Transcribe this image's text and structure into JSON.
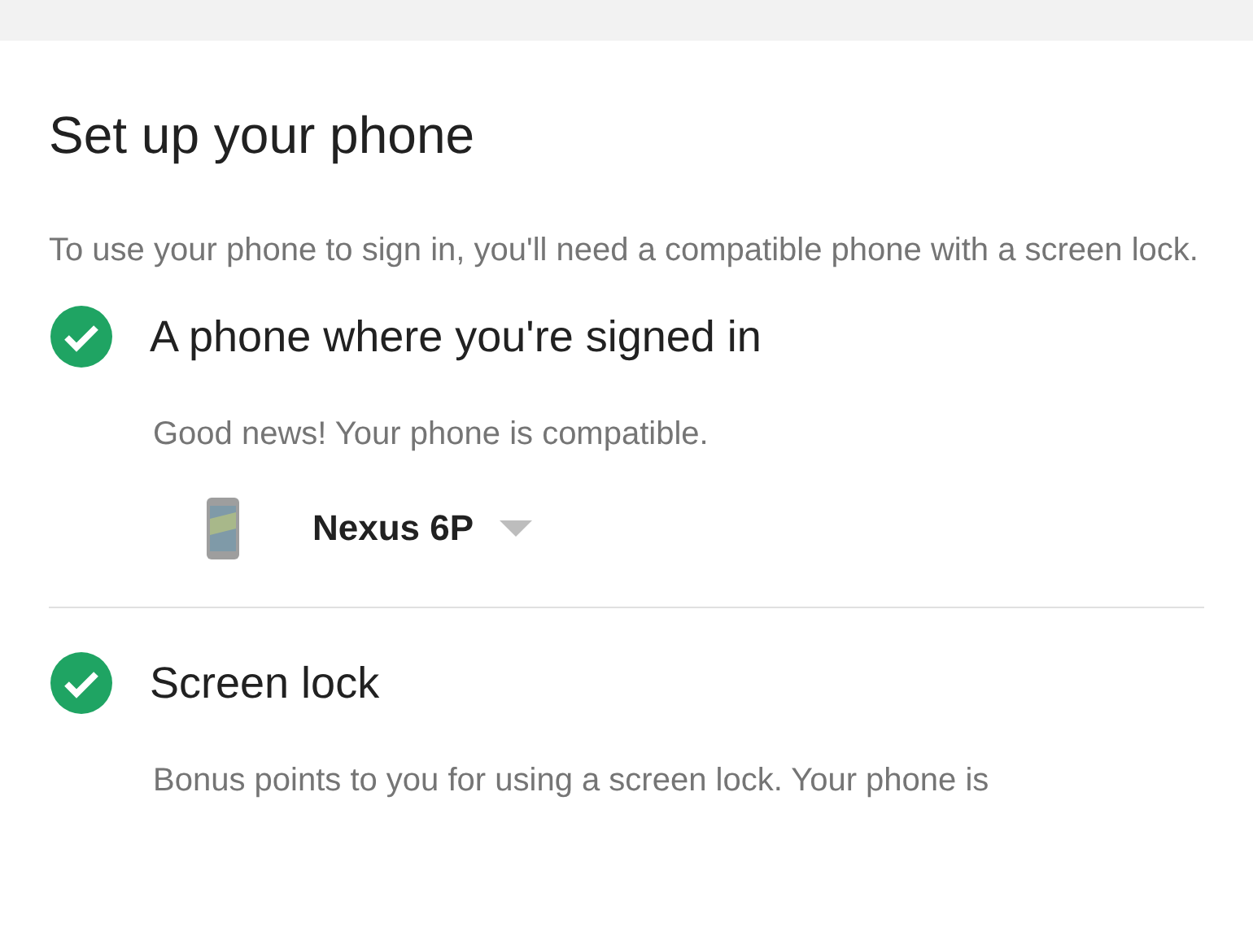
{
  "title": "Set up your phone",
  "intro": "To use your phone to sign in, you'll need a compatible phone with a screen lock.",
  "requirements": [
    {
      "title": "A phone where you're signed in",
      "checked": true,
      "description": "Good news! Your phone is compatible.",
      "device": {
        "name": "Nexus 6P"
      }
    },
    {
      "title": "Screen lock",
      "checked": true,
      "description": "Bonus points to you for using a screen lock. Your phone is"
    }
  ]
}
